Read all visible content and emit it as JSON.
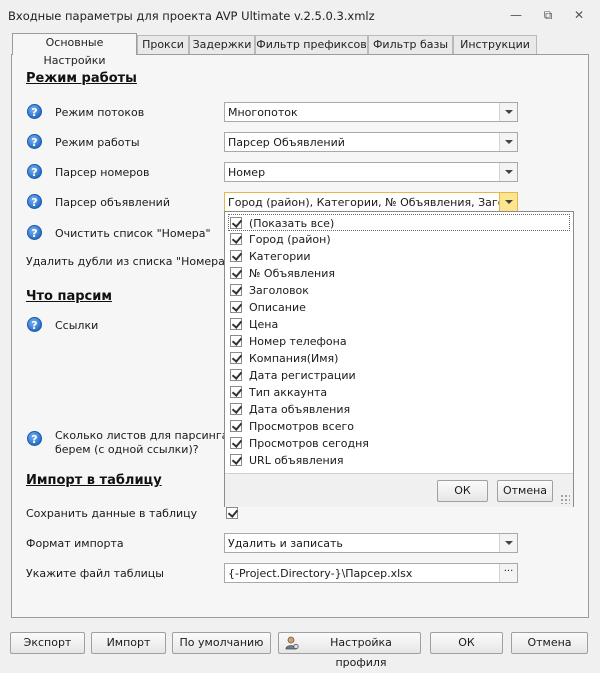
{
  "window": {
    "title": "Входные параметры для проекта AVP Ultimate v.2.5.0.3.xmlz",
    "minimize_glyph": "—",
    "restore_glyph": "⧉",
    "close_glyph": "✕"
  },
  "tabs": [
    {
      "label": "Основные Настройки",
      "active": true
    },
    {
      "label": "Прокси",
      "active": false
    },
    {
      "label": "Задержки",
      "active": false
    },
    {
      "label": "Фильтр префиксов",
      "active": false
    },
    {
      "label": "Фильтр базы",
      "active": false
    },
    {
      "label": "Инструкции",
      "active": false
    }
  ],
  "sections": {
    "mode": "Режим работы",
    "what": "Что парсим",
    "import": "Импорт в таблицу"
  },
  "fields": {
    "threads": {
      "label": "Режим потоков",
      "value": "Многопоток"
    },
    "work_mode": {
      "label": "Режим работы",
      "value": "Парсер Объявлений"
    },
    "number_parser": {
      "label": "Парсер номеров",
      "value": "Номер"
    },
    "ads_parser": {
      "label": "Парсер объявлений",
      "value": "Город (район), Категории, № Объявления, Заголо..."
    },
    "clear_list": {
      "label": "Очистить список \"Номера\""
    },
    "remove_dupes": {
      "label": "Удалить дубли из списка \"Номера\""
    },
    "links": {
      "label": "Ссылки"
    },
    "sheets_count": {
      "label_line1": "Сколько листов для парсинга",
      "label_line2": "берем (с одной ссылки)?"
    },
    "save_to_table": {
      "label": "Сохранить данные в таблицу",
      "checked": true
    },
    "import_format": {
      "label": "Формат импорта",
      "value": "Удалить и записать"
    },
    "table_file": {
      "label": "Укажите файл таблицы",
      "value": "{-Project.Directory-}\\Парсер.xlsx",
      "browse": "···"
    }
  },
  "help_glyph": "?",
  "dropdown": {
    "items": [
      {
        "label": "(Показать все)",
        "checked": true
      },
      {
        "label": "Город (район)",
        "checked": true
      },
      {
        "label": "Категории",
        "checked": true
      },
      {
        "label": "№ Объявления",
        "checked": true
      },
      {
        "label": "Заголовок",
        "checked": true
      },
      {
        "label": "Описание",
        "checked": true
      },
      {
        "label": "Цена",
        "checked": true
      },
      {
        "label": "Номер телефона",
        "checked": true
      },
      {
        "label": "Компания(Имя)",
        "checked": true
      },
      {
        "label": "Дата регистрации",
        "checked": true
      },
      {
        "label": "Тип аккаунта",
        "checked": true
      },
      {
        "label": "Дата объявления",
        "checked": true
      },
      {
        "label": "Просмотров всего",
        "checked": true
      },
      {
        "label": "Просмотров сегодня",
        "checked": true
      },
      {
        "label": "URL объявления",
        "checked": true
      }
    ],
    "ok": "ОК",
    "cancel": "Отмена"
  },
  "bottom_buttons": {
    "export": "Экспорт",
    "import": "Импорт",
    "default": "По умолчанию",
    "profile": "Настройка профиля",
    "ok": "ОК",
    "cancel": "Отмена"
  },
  "colors": {
    "accent_dropdown": "#fde48f",
    "help_icon": "#2a6fc9"
  }
}
